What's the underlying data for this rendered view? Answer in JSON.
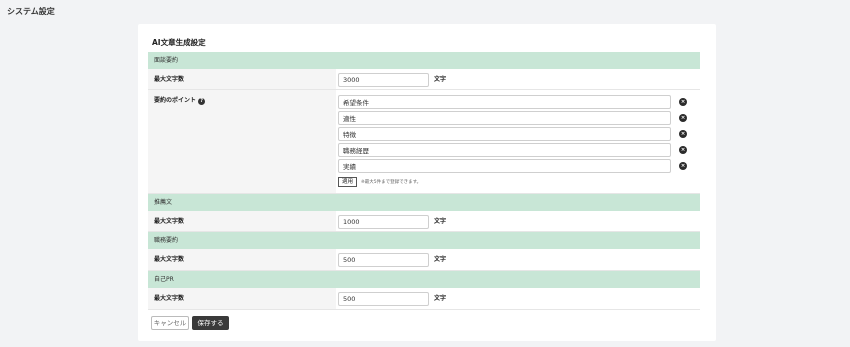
{
  "page": {
    "title": "システム設定"
  },
  "card": {
    "title": "AI文章生成設定"
  },
  "sections": {
    "summary": {
      "header": "面談要約",
      "max_chars_label": "最大文字数",
      "max_chars_value": "3000",
      "unit": "文字",
      "points_label": "要約のポイント",
      "points": [
        "希望条件",
        "適性",
        "特徴",
        "職務経歴",
        "実績"
      ],
      "apply_label": "適用",
      "apply_note": "※最大5件まで登録できます。"
    },
    "recommendation": {
      "header": "推薦文",
      "max_chars_label": "最大文字数",
      "max_chars_value": "1000",
      "unit": "文字"
    },
    "career": {
      "header": "職務要約",
      "max_chars_label": "最大文字数",
      "max_chars_value": "500",
      "unit": "文字"
    },
    "pr": {
      "header": "自己PR",
      "max_chars_label": "最大文字数",
      "max_chars_value": "500",
      "unit": "文字"
    }
  },
  "actions": {
    "cancel_label": "キャンセル",
    "save_label": "保存する"
  },
  "icons": {
    "help": "question-circle-icon",
    "remove": "close-circle-icon"
  }
}
